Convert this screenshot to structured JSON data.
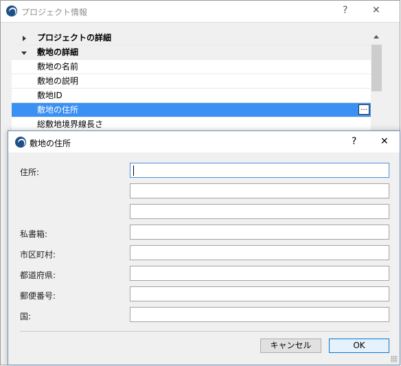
{
  "background_dialog": {
    "title": "プロジェクト情報",
    "help_label": "?",
    "close_label": "✕",
    "tree": {
      "groups": [
        {
          "label": "プロジェクトの詳細",
          "expanded": false
        },
        {
          "label": "敷地の詳細",
          "expanded": true
        }
      ],
      "items": [
        {
          "label": "敷地の名前"
        },
        {
          "label": "敷地の説明"
        },
        {
          "label": "敷地ID"
        },
        {
          "label": "敷地の住所",
          "selected": true,
          "button": "..."
        },
        {
          "label": "総敷地境界線長さ"
        }
      ]
    }
  },
  "address_dialog": {
    "title": "敷地の住所",
    "help_label": "?",
    "close_label": "✕",
    "fields": {
      "address_label": "住所:",
      "address1": "",
      "address2": "",
      "address3": "",
      "po_box_label": "私書箱:",
      "po_box": "",
      "city_label": "市区町村:",
      "city": "",
      "prefecture_label": "都道府県:",
      "prefecture": "",
      "postal_code_label": "郵便番号:",
      "postal_code": "",
      "country_label": "国:",
      "country": ""
    },
    "buttons": {
      "cancel": "キャンセル",
      "ok": "OK"
    }
  },
  "colors": {
    "selection": "#3b90f3",
    "app_icon": "#1e4f87",
    "primary_button_border": "#0078d7"
  }
}
